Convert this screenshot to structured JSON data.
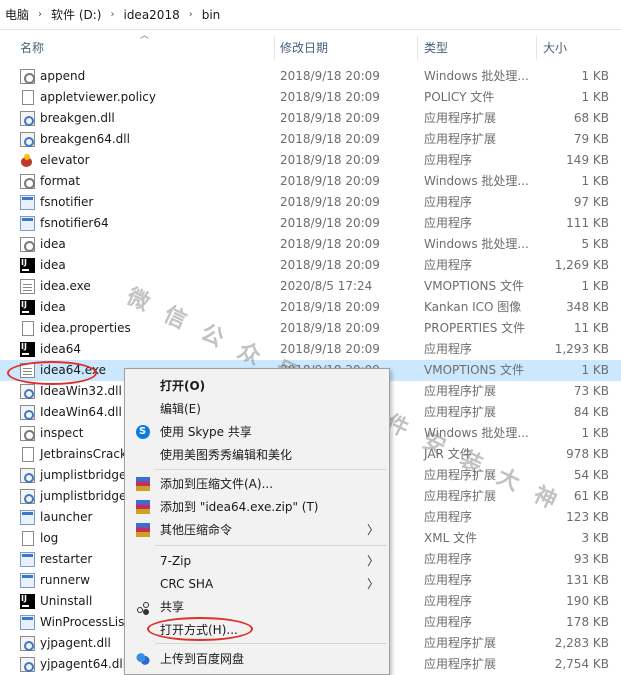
{
  "breadcrumb": [
    {
      "label": "电脑"
    },
    {
      "label": "软件 (D:)"
    },
    {
      "label": "idea2018"
    },
    {
      "label": "bin"
    }
  ],
  "columns": {
    "name": "名称",
    "date": "修改日期",
    "type": "类型",
    "size": "大小"
  },
  "files": [
    {
      "name": "append",
      "date": "2018/9/18 20:09",
      "type": "Windows 批处理...",
      "size": "1 KB",
      "icon": "batch-file-icon"
    },
    {
      "name": "appletviewer.policy",
      "date": "2018/9/18 20:09",
      "type": "POLICY 文件",
      "size": "1 KB",
      "icon": "file-icon"
    },
    {
      "name": "breakgen.dll",
      "date": "2018/9/18 20:09",
      "type": "应用程序扩展",
      "size": "68 KB",
      "icon": "dll-icon"
    },
    {
      "name": "breakgen64.dll",
      "date": "2018/9/18 20:09",
      "type": "应用程序扩展",
      "size": "79 KB",
      "icon": "dll-icon"
    },
    {
      "name": "elevator",
      "date": "2018/9/18 20:09",
      "type": "应用程序",
      "size": "149 KB",
      "icon": "elevator-app-icon"
    },
    {
      "name": "format",
      "date": "2018/9/18 20:09",
      "type": "Windows 批处理...",
      "size": "1 KB",
      "icon": "batch-file-icon"
    },
    {
      "name": "fsnotifier",
      "date": "2018/9/18 20:09",
      "type": "应用程序",
      "size": "97 KB",
      "icon": "exe-icon"
    },
    {
      "name": "fsnotifier64",
      "date": "2018/9/18 20:09",
      "type": "应用程序",
      "size": "111 KB",
      "icon": "exe-icon"
    },
    {
      "name": "idea",
      "date": "2018/9/18 20:09",
      "type": "Windows 批处理...",
      "size": "5 KB",
      "icon": "batch-file-icon"
    },
    {
      "name": "idea",
      "date": "2018/9/18 20:09",
      "type": "应用程序",
      "size": "1,269 KB",
      "icon": "intellij-icon"
    },
    {
      "name": "idea.exe",
      "date": "2020/8/5 17:24",
      "type": "VMOPTIONS 文件",
      "size": "1 KB",
      "icon": "vmoptions-file-icon"
    },
    {
      "name": "idea",
      "date": "2018/9/18 20:09",
      "type": "Kankan ICO 图像",
      "size": "348 KB",
      "icon": "intellij-icon"
    },
    {
      "name": "idea.properties",
      "date": "2018/9/18 20:09",
      "type": "PROPERTIES 文件",
      "size": "11 KB",
      "icon": "file-icon"
    },
    {
      "name": "idea64",
      "date": "2018/9/18 20:09",
      "type": "应用程序",
      "size": "1,293 KB",
      "icon": "intellij-icon"
    },
    {
      "name": "idea64.exe",
      "date": "2018/9/18 20:09",
      "type": "VMOPTIONS 文件",
      "size": "1 KB",
      "icon": "vmoptions-file-icon",
      "selected": true
    },
    {
      "name": "IdeaWin32.dll",
      "date": "2018/9/18 20:09",
      "type": "应用程序扩展",
      "size": "73 KB",
      "icon": "dll-icon"
    },
    {
      "name": "IdeaWin64.dll",
      "date": "2018/9/18 20:09",
      "type": "应用程序扩展",
      "size": "84 KB",
      "icon": "dll-icon"
    },
    {
      "name": "inspect",
      "date": "2018/9/18 20:09",
      "type": "Windows 批处理...",
      "size": "1 KB",
      "icon": "batch-file-icon"
    },
    {
      "name": "JetbrainsCrack",
      "date": "2018/9/18 20:09",
      "type": "JAR 文件",
      "size": "978 KB",
      "icon": "file-icon"
    },
    {
      "name": "jumplistbridge",
      "date": "2018/9/18 20:09",
      "type": "应用程序扩展",
      "size": "54 KB",
      "icon": "dll-icon"
    },
    {
      "name": "jumplistbridge",
      "date": "2018/9/18 20:09",
      "type": "应用程序扩展",
      "size": "61 KB",
      "icon": "dll-icon"
    },
    {
      "name": "launcher",
      "date": "2018/9/18 20:09",
      "type": "应用程序",
      "size": "123 KB",
      "icon": "exe-icon"
    },
    {
      "name": "log",
      "date": "2018/9/18 20:09",
      "type": "XML 文件",
      "size": "3 KB",
      "icon": "file-icon"
    },
    {
      "name": "restarter",
      "date": "2018/9/18 20:09",
      "type": "应用程序",
      "size": "93 KB",
      "icon": "exe-icon"
    },
    {
      "name": "runnerw",
      "date": "2018/9/18 20:09",
      "type": "应用程序",
      "size": "131 KB",
      "icon": "exe-icon"
    },
    {
      "name": "Uninstall",
      "date": "2018/9/18 20:09",
      "type": "应用程序",
      "size": "190 KB",
      "icon": "intellij-icon"
    },
    {
      "name": "WinProcessList",
      "date": "2018/9/18 20:09",
      "type": "应用程序",
      "size": "178 KB",
      "icon": "exe-icon"
    },
    {
      "name": "yjpagent.dll",
      "date": "2018/9/18 20:09",
      "type": "应用程序扩展",
      "size": "2,283 KB",
      "icon": "dll-icon"
    },
    {
      "name": "yjpagent64.dll",
      "date": "2018/9/18 20:09",
      "type": "应用程序扩展",
      "size": "2,754 KB",
      "icon": "dll-icon"
    }
  ],
  "context_menu": {
    "open": "打开(O)",
    "edit": "编辑(E)",
    "skype_share": "使用 Skype 共享",
    "meitu": "使用美图秀秀编辑和美化",
    "add_archive": "添加到压缩文件(A)...",
    "add_zip": "添加到 \"idea64.exe.zip\" (T)",
    "other_compress": "其他压缩命令",
    "sevenzip": "7-Zip",
    "crc": "CRC SHA",
    "share": "共享",
    "open_with": "打开方式(H)...",
    "baidu": "上传到百度网盘"
  },
  "watermark": "微信公众号：软件安装大神",
  "colors": {
    "selection": "#cce8ff",
    "annotation": "#e0302a",
    "header_text": "#4c607a"
  }
}
